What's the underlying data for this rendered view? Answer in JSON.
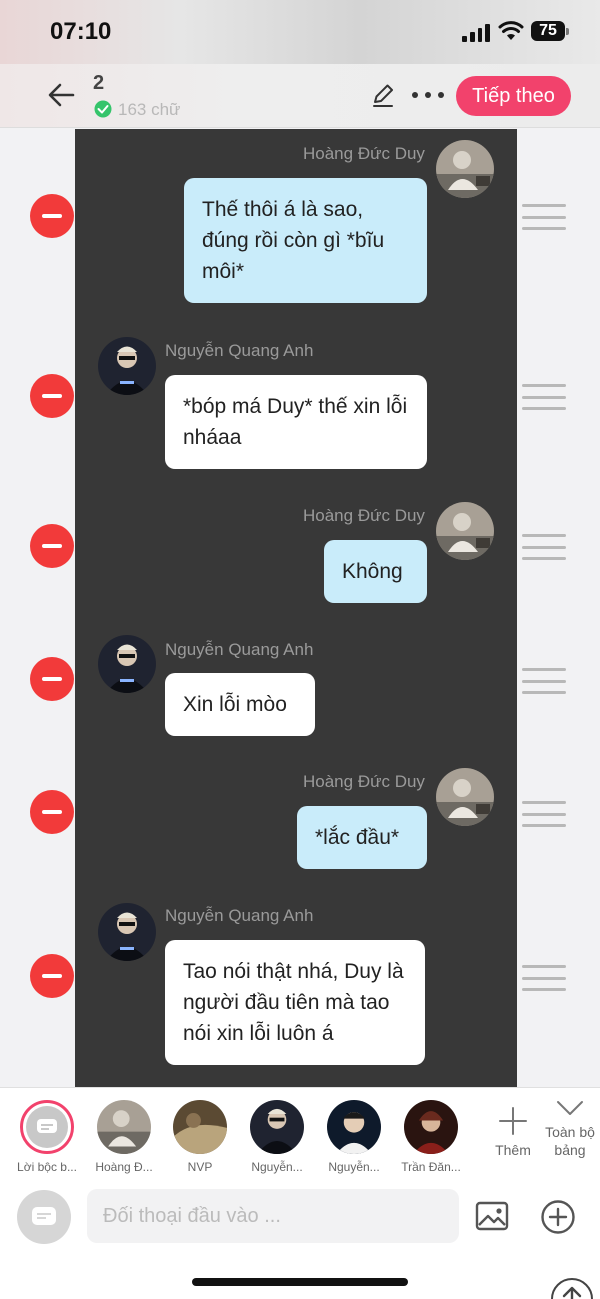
{
  "status_bar": {
    "time": "07:10",
    "battery": "75"
  },
  "header": {
    "count": "2",
    "word_count": "163 chữ",
    "next_label": "Tiếp theo"
  },
  "messages": [
    {
      "sender": "Hoàng Đức Duy",
      "text": "Thế thôi á là sao, đúng rồi còn gì *bĩu môi*"
    },
    {
      "sender": "Nguyễn Quang Anh",
      "text": "*bóp má Duy* thế xin lỗi nháaa"
    },
    {
      "sender": "Hoàng Đức Duy",
      "text": "Không"
    },
    {
      "sender": "Nguyễn Quang Anh",
      "text": "Xin lỗi mòo"
    },
    {
      "sender": "Hoàng Đức Duy",
      "text": "*lắc đầu*"
    },
    {
      "sender": "Nguyễn Quang Anh",
      "text": "Tao nói thật nhá, Duy là người đầu tiên mà tao nói xin lỗi luôn á"
    }
  ],
  "characters": [
    {
      "name": "Lời bộc b..."
    },
    {
      "name": "Hoàng Đ..."
    },
    {
      "name": "NVP"
    },
    {
      "name": "Nguyễn..."
    },
    {
      "name": "Nguyễn..."
    },
    {
      "name": "Trần Đăn..."
    }
  ],
  "char_bar": {
    "add_label": "Thêm",
    "toggle_label": "Toàn bộ bảng"
  },
  "input": {
    "placeholder": "Đối thoại đầu vào ..."
  },
  "colors": {
    "accent": "#f2426c",
    "delete": "#f23a3a",
    "my_bubble": "#c9ecfa",
    "chat_bg": "#383838"
  }
}
